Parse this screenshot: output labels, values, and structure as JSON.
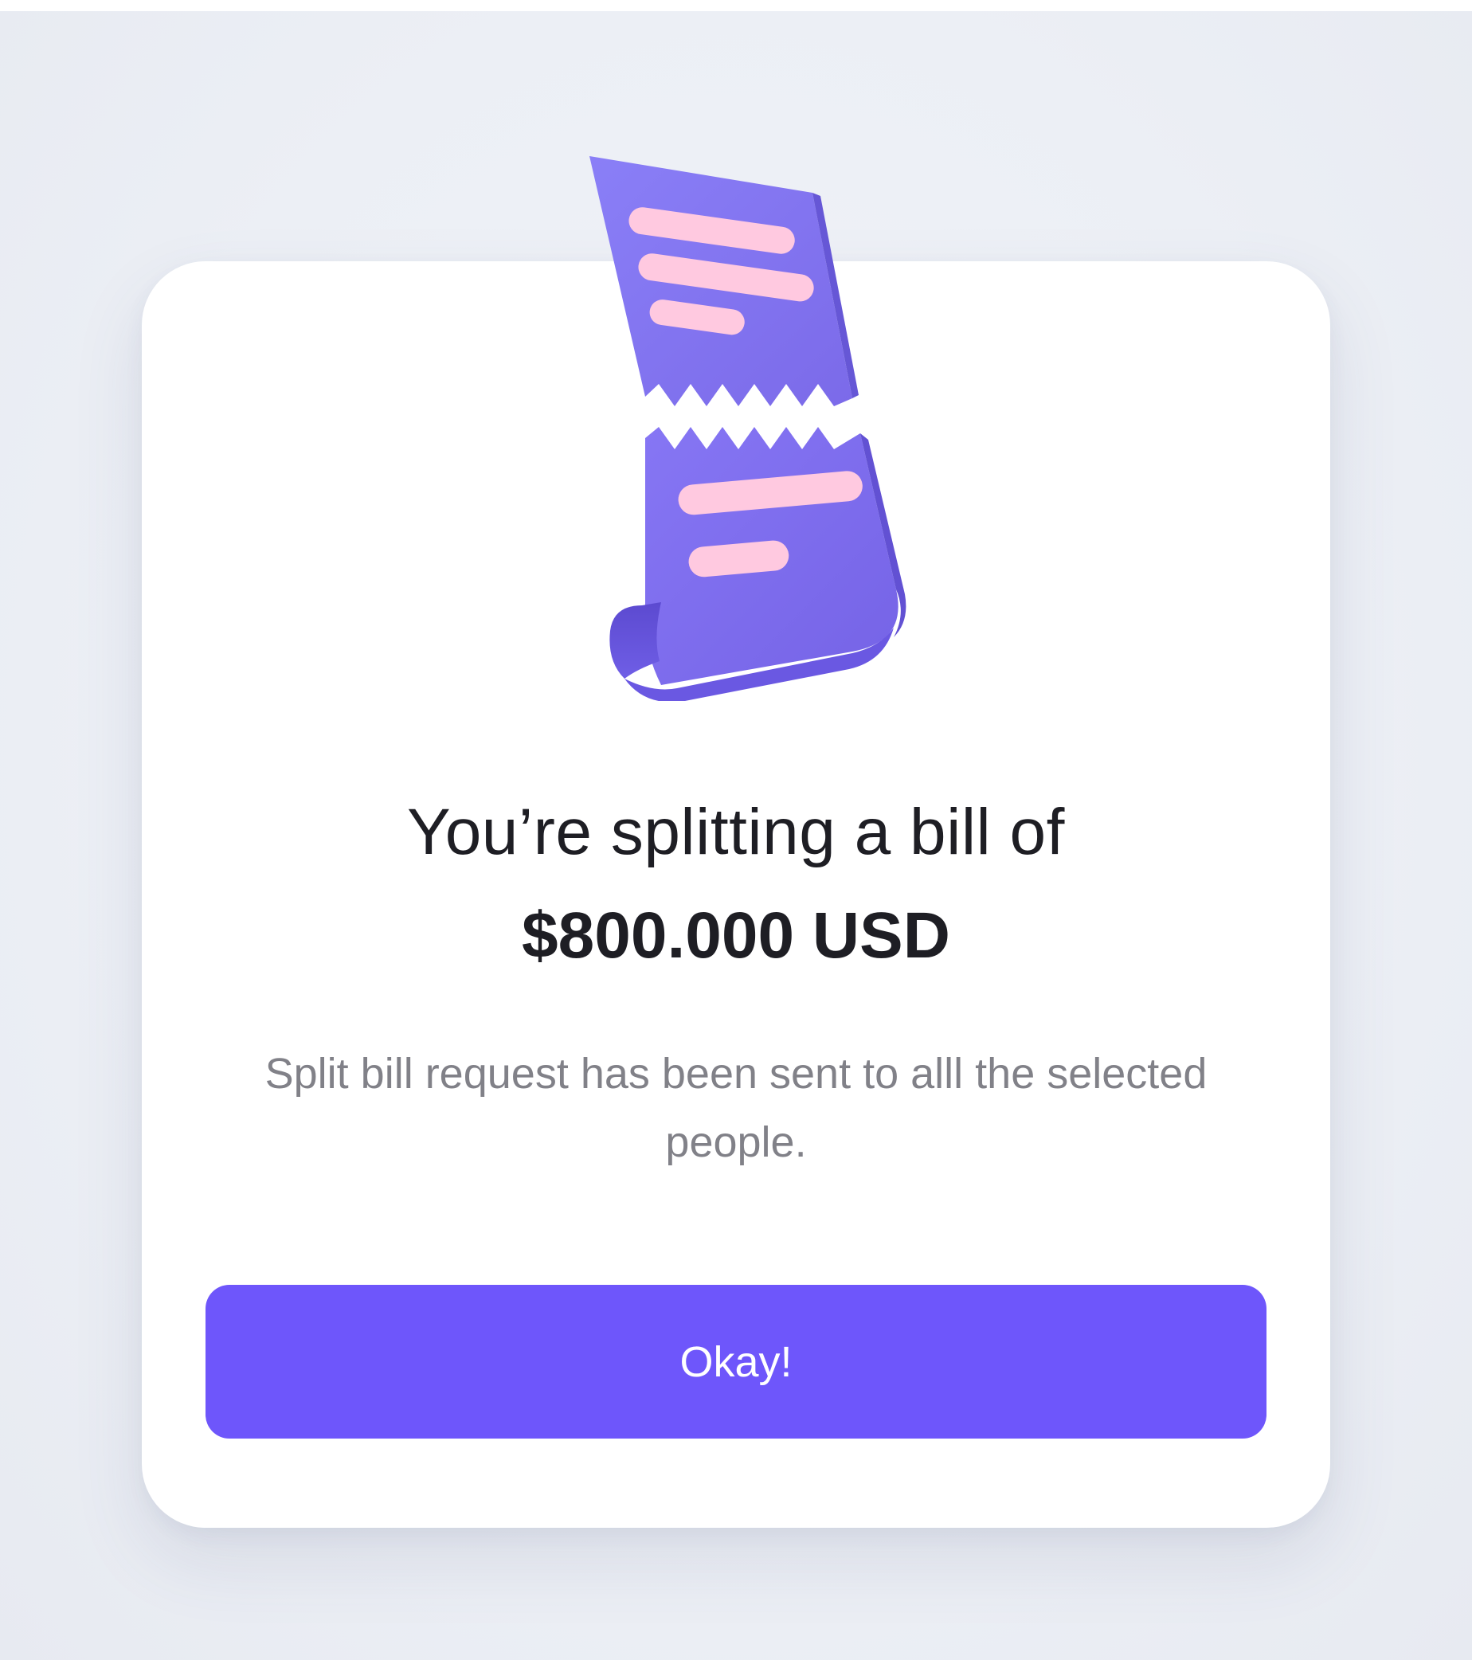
{
  "dialog": {
    "title": "You’re splitting a bill of",
    "amount": "$800.000 USD",
    "message": "Split bill request has been sent to alll the selected people.",
    "button_label": "Okay!",
    "illustration_icon": "torn-receipt-icon"
  },
  "colors": {
    "accent": "#6e56fb",
    "receipt": "#8576f2",
    "receipt_lines": "#ffc9e0",
    "text_primary": "#1e1e24",
    "text_secondary": "#818188",
    "background": "#eef1f7"
  }
}
